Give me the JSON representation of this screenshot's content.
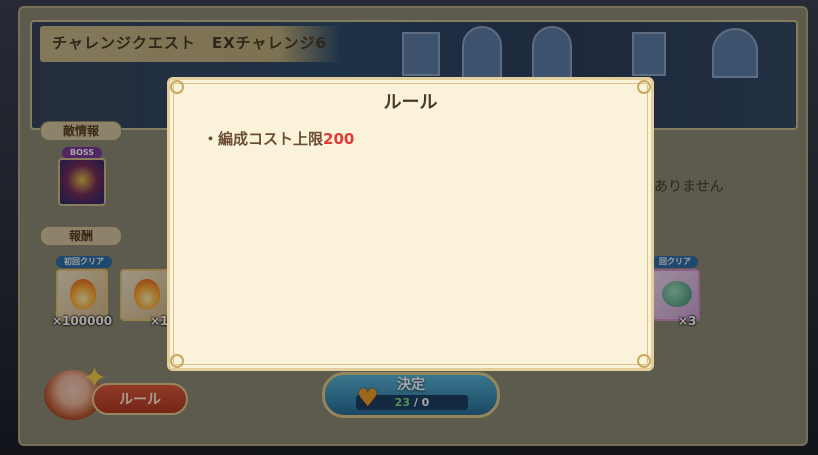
{
  "header": {
    "title": "チャレンジクエスト　EXチャレンジ6"
  },
  "enemy_section": {
    "label": "敵情報",
    "boss_tag": "BOSS",
    "partial_text": "ありません"
  },
  "reward_section": {
    "label": "報酬",
    "first_clear_tag": "初回クリア",
    "rewards": [
      {
        "qty": "×100000"
      },
      {
        "qty": "×1"
      }
    ],
    "right_tag": "回クリア",
    "right_qty": "×3"
  },
  "modal": {
    "title": "ルール",
    "rule_prefix": "・編成コスト上限",
    "rule_value": "200"
  },
  "footer": {
    "rule_button": "ルール",
    "decide_button": "決定",
    "stamina_current": "23",
    "stamina_sep": " / ",
    "stamina_cost": "0"
  },
  "colors": {
    "accent_red": "#e03a3a",
    "stamina_green": "#7ee07e",
    "modal_bg": "#fbf3d9"
  },
  "icons": {
    "boss_portrait": "boss-portrait-icon",
    "flame": "flame-icon",
    "heart": "heart-icon",
    "fish": "fish-monster-icon"
  }
}
